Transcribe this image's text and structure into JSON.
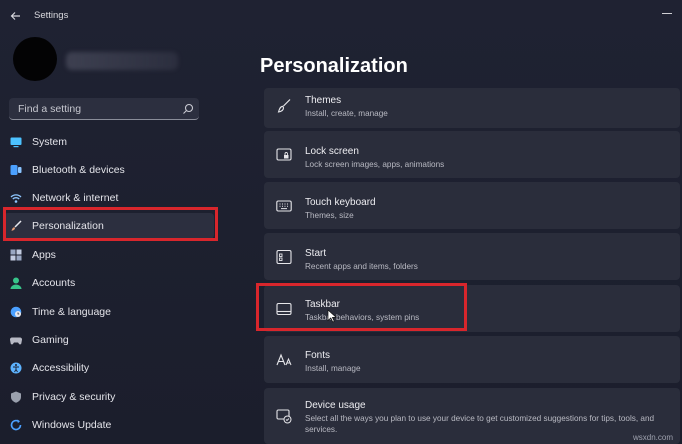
{
  "window": {
    "title": "Settings"
  },
  "search": {
    "placeholder": "Find a setting"
  },
  "sidebar": {
    "items": [
      {
        "label": "System",
        "icon": "monitor-icon",
        "color": "#4cc2ff"
      },
      {
        "label": "Bluetooth & devices",
        "icon": "bluetooth-icon",
        "color": "#4ba0ff"
      },
      {
        "label": "Network & internet",
        "icon": "wifi-icon",
        "color": "#8fc7ff"
      },
      {
        "label": "Personalization",
        "icon": "brush-icon",
        "color": "#e5a07a",
        "selected": true,
        "highlighted": true
      },
      {
        "label": "Apps",
        "icon": "apps-icon",
        "color": "#9aa7c2"
      },
      {
        "label": "Accounts",
        "icon": "person-icon",
        "color": "#37c58a"
      },
      {
        "label": "Time & language",
        "icon": "globe-clock-icon",
        "color": "#4ba0ff"
      },
      {
        "label": "Gaming",
        "icon": "gamepad-icon",
        "color": "#b7b9c4"
      },
      {
        "label": "Accessibility",
        "icon": "accessibility-icon",
        "color": "#5db3ff"
      },
      {
        "label": "Privacy & security",
        "icon": "shield-icon",
        "color": "#9aa0ad"
      },
      {
        "label": "Windows Update",
        "icon": "update-icon",
        "color": "#4ba0ff"
      }
    ]
  },
  "main": {
    "title": "Personalization",
    "cards": [
      {
        "title": "Themes",
        "subtitle": "Install, create, manage",
        "icon": "brush-icon"
      },
      {
        "title": "Lock screen",
        "subtitle": "Lock screen images, apps, animations",
        "icon": "lock-screen-icon"
      },
      {
        "title": "Touch keyboard",
        "subtitle": "Themes, size",
        "icon": "keyboard-icon"
      },
      {
        "title": "Start",
        "subtitle": "Recent apps and items, folders",
        "icon": "start-icon"
      },
      {
        "title": "Taskbar",
        "subtitle": "Taskbar behaviors, system pins",
        "icon": "taskbar-icon",
        "highlighted": true
      },
      {
        "title": "Fonts",
        "subtitle": "Install, manage",
        "icon": "fonts-icon"
      },
      {
        "title": "Device usage",
        "subtitle": "Select all the ways you plan to use your device to get customized suggestions for tips, tools, and",
        "subtitle2": "services.",
        "icon": "device-usage-icon"
      }
    ]
  },
  "watermark": "wsxdn.com",
  "colors": {
    "highlight": "#d8262c",
    "background": "#1d2030",
    "card": "#2a2d3b"
  }
}
